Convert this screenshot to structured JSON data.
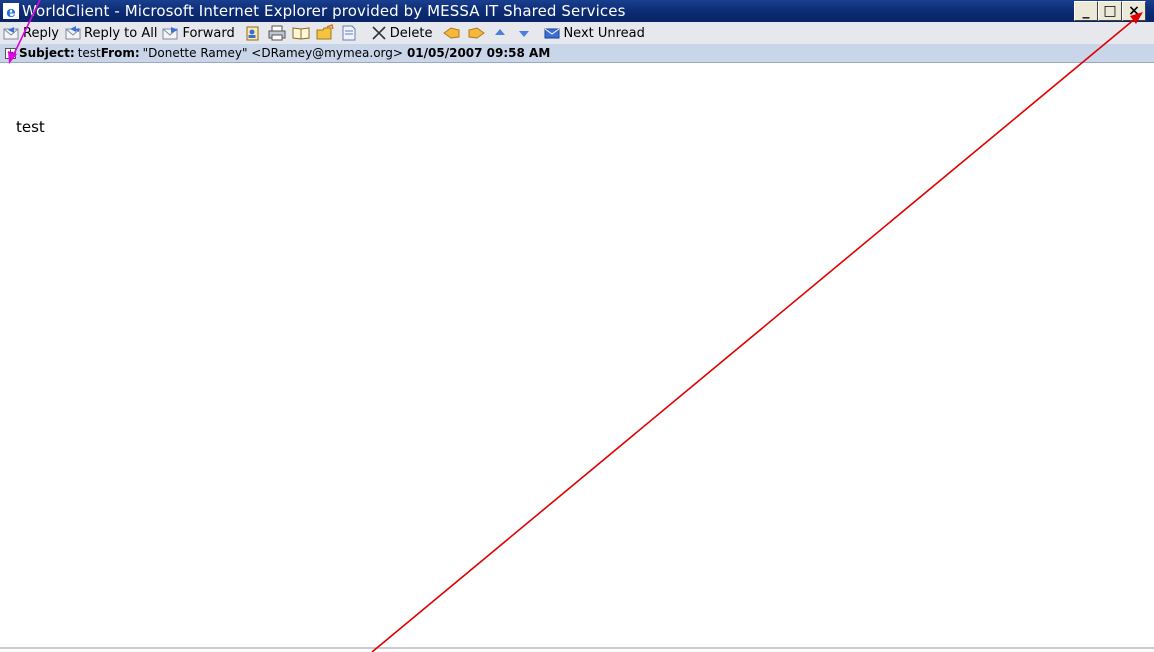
{
  "window": {
    "title": "WorldClient - Microsoft Internet Explorer provided by MESSA IT Shared Services",
    "minimize_label": "_",
    "maximize_label": "□",
    "close_label": "×"
  },
  "toolbar": {
    "reply_label": "Reply",
    "reply_all_label": "Reply to All",
    "forward_label": "Forward",
    "delete_label": "Delete",
    "next_unread_label": "Next Unread"
  },
  "header": {
    "expand_label": "+",
    "subject_label": "Subject:",
    "subject_value": "test",
    "from_label": "From:",
    "from_value": "\"Donette Ramey\" <DRamey@mymea.org>",
    "date_value": "01/05/2007 09:58 AM"
  },
  "body": {
    "text": "test"
  },
  "colors": {
    "title_bar": "#0c2c74",
    "toolbar_bg": "#e6e8ee",
    "header_bg": "#c9d5e8",
    "annotation_arrow": "#e00000",
    "annotation_arrow_2": "#e000e0"
  }
}
